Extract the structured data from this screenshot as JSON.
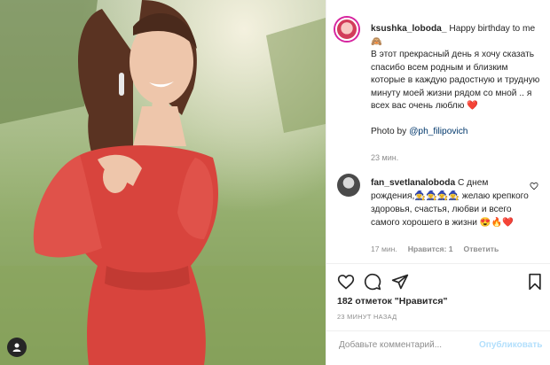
{
  "photo": {
    "avatar_icon": "user-icon"
  },
  "caption": {
    "username": "ksushka_loboda_",
    "text_intro": "Happy birthday to me 🙈",
    "text_body": "В этот прекрасный день я хочу сказать спасибо всем родным и близким которые в каждую радостную и трудную минуту моей жизни рядом со мной .. я всех вас очень люблю ❤️",
    "photo_by": "Photo by",
    "mention": "@ph_filipovich",
    "time": "23 мин."
  },
  "comment": {
    "username": "fan_svetlanaloboda",
    "text": "С днем рождения,🧙‍♀️🧙‍♀️🧙‍♀️🧙‍♀️ желаю крепкого здоровья, счастья, любви и всего самого хорошего в жизни 😍🔥❤️",
    "time": "17 мин.",
    "likes": "Нравится: 1",
    "reply": "Ответить"
  },
  "actions": {
    "likes_text": "182 отметок \"Нравится\"",
    "posted_ago": "23 МИНУТ НАЗАД",
    "icons": [
      "heart-icon",
      "comment-icon",
      "share-icon",
      "bookmark-icon"
    ]
  },
  "add_comment": {
    "placeholder": "Добавьте комментарий...",
    "publish_label": "Опубликовать"
  },
  "colors": {
    "link": "#00376b",
    "publish_disabled": "#b2dffc",
    "dress": "#d8443d"
  }
}
